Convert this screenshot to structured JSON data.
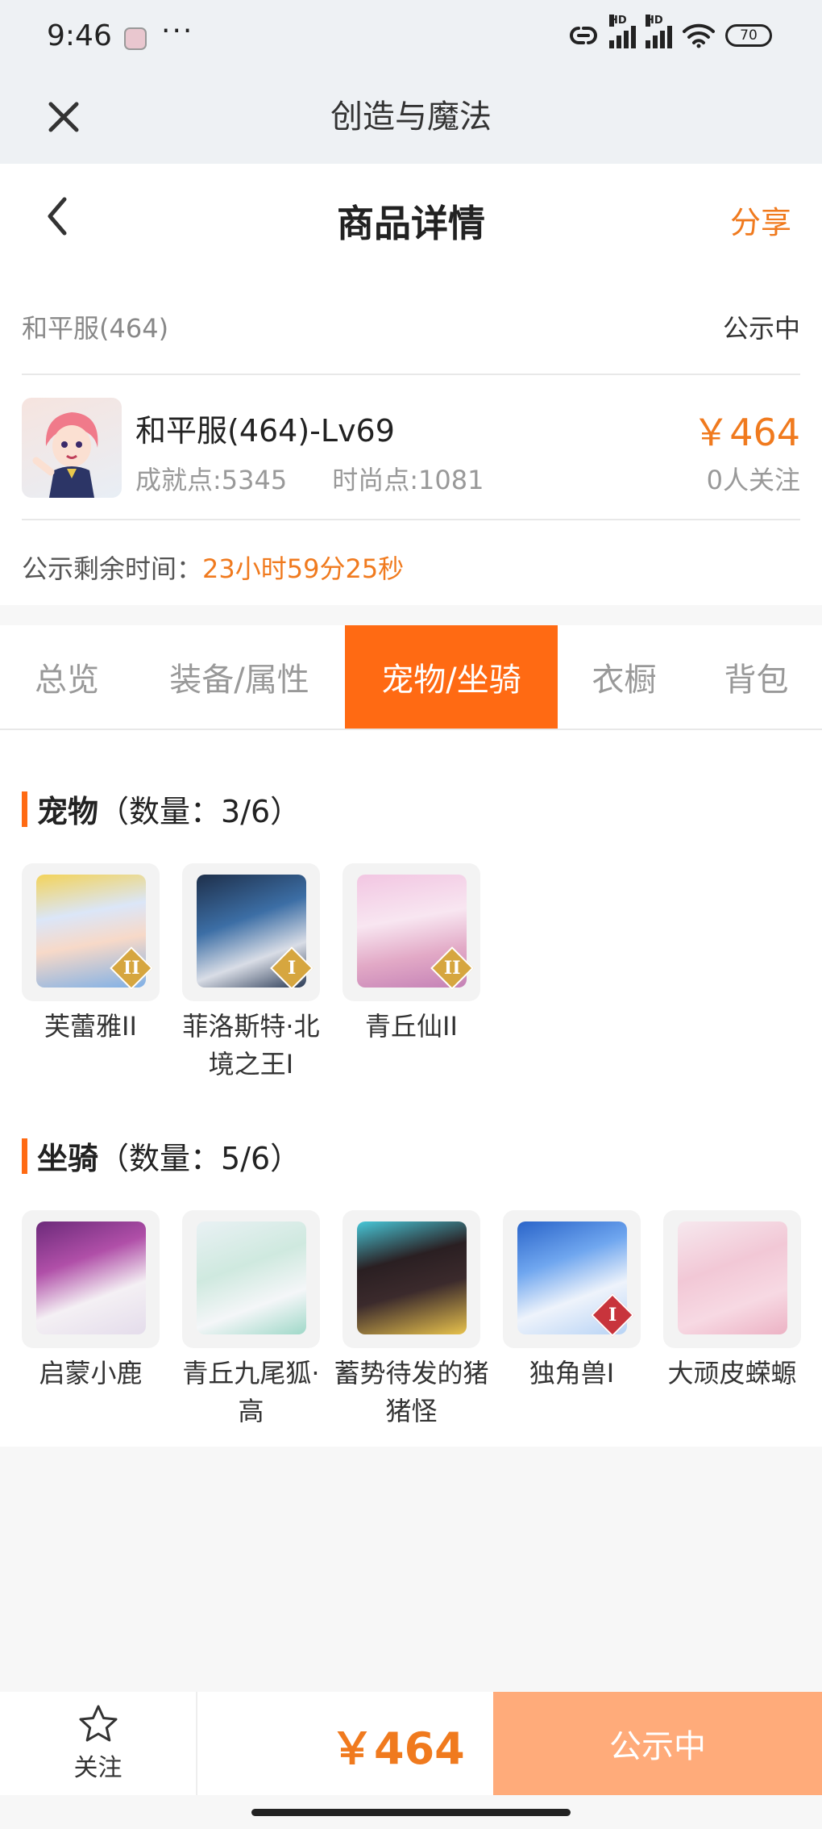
{
  "status_bar": {
    "time": "9:46",
    "dots": "···",
    "battery": "70"
  },
  "topbar": {
    "title": "创造与魔法"
  },
  "header": {
    "title": "商品详情",
    "share": "分享"
  },
  "info": {
    "server": "和平服(464)",
    "status": "公示中",
    "product_name": "和平服(464)-Lv69",
    "achievement": "成就点:5345",
    "fashion": "时尚点:1081",
    "price": "￥464",
    "followers": "0人关注",
    "remain_label": "公示剩余时间：",
    "remain_time": "23小时59分25秒"
  },
  "tabs": [
    {
      "label": "总览",
      "active": false
    },
    {
      "label": "装备/属性",
      "active": false
    },
    {
      "label": "宠物/坐骑",
      "active": true
    },
    {
      "label": "衣橱",
      "active": false
    },
    {
      "label": "背包",
      "active": false
    }
  ],
  "pets": {
    "title": "宠物",
    "count": "（数量：3/6）",
    "items": [
      {
        "name": "芙蕾雅II",
        "badge": "II",
        "badge_color": "#d6a63f",
        "art": "linear-gradient(170deg,#f3d35a 0%,#dbe6f8 35%,#f7d9c8 60%,#7fb0e6 100%)"
      },
      {
        "name": "菲洛斯特·北境之王I",
        "badge": "I",
        "badge_color": "#d6a63f",
        "art": "linear-gradient(160deg,#1e2f4a 0%,#3c6ea5 40%,#d9dde6 70%,#2a3a55 100%)"
      },
      {
        "name": "青丘仙II",
        "badge": "II",
        "badge_color": "#d6a63f",
        "art": "linear-gradient(170deg,#f2c6e2 0%,#f8e6f1 40%,#e2a9c6 70%,#c481b6 100%)"
      }
    ]
  },
  "mounts": {
    "title": "坐骑",
    "count": "（数量：5/6）",
    "items": [
      {
        "name": "启蒙小鹿",
        "badge": "",
        "badge_color": "",
        "art": "linear-gradient(160deg,#6c2a7a 0%,#b04fa8 35%,#f4f0f4 65%,#e4dceb 100%)"
      },
      {
        "name": "青丘九尾狐·高",
        "badge": "",
        "badge_color": "",
        "art": "linear-gradient(160deg,#e9f1f4 0%,#cfe9df 40%,#f4f6f8 70%,#9fd8c8 100%)"
      },
      {
        "name": "蓄势待发的猪猪怪",
        "badge": "",
        "badge_color": "",
        "art": "linear-gradient(165deg,#47c7d8 0%,#2a1f22 35%,#3b2a2c 60%,#e8c24c 100%)"
      },
      {
        "name": "独角兽I",
        "badge": "I",
        "badge_color": "#c8343c",
        "art": "linear-gradient(160deg,#2a64c9 0%,#6fa6ef 35%,#eef3fb 65%,#b7d3f5 100%)"
      },
      {
        "name": "大顽皮蝾螈",
        "badge": "",
        "badge_color": "",
        "art": "linear-gradient(160deg,#f6e8ee 0%,#f2c8d6 40%,#f7d9e3 70%,#ecb2c4 100%)"
      }
    ]
  },
  "footer": {
    "follow_label": "关注",
    "price": "￥464",
    "action": "公示中"
  },
  "colors": {
    "accent": "#ff6a13",
    "price": "#f07a1e",
    "action_bg": "#ffab7a"
  }
}
